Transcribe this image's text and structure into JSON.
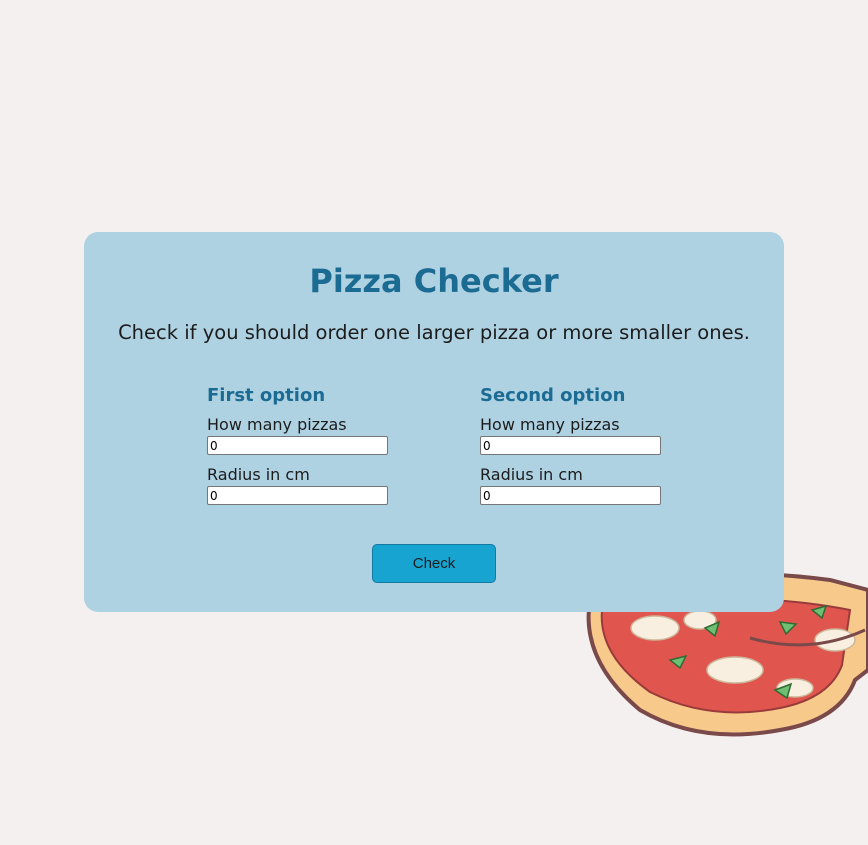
{
  "header": {
    "title": "Pizza Checker",
    "subtitle": "Check if you should order one larger pizza or more smaller ones."
  },
  "options": [
    {
      "heading": "First option",
      "count_label": "How many pizzas",
      "count_value": "0",
      "radius_label": "Radius in cm",
      "radius_value": "0"
    },
    {
      "heading": "Second option",
      "count_label": "How many pizzas",
      "count_value": "0",
      "radius_label": "Radius in cm",
      "radius_value": "0"
    }
  ],
  "actions": {
    "check_label": "Check"
  },
  "colors": {
    "background": "#f5f0f0",
    "card": "#afd2e3",
    "heading": "#1b6b93",
    "button": "#17a4d0"
  },
  "icons": {
    "decoration": "pizza-illustration"
  }
}
